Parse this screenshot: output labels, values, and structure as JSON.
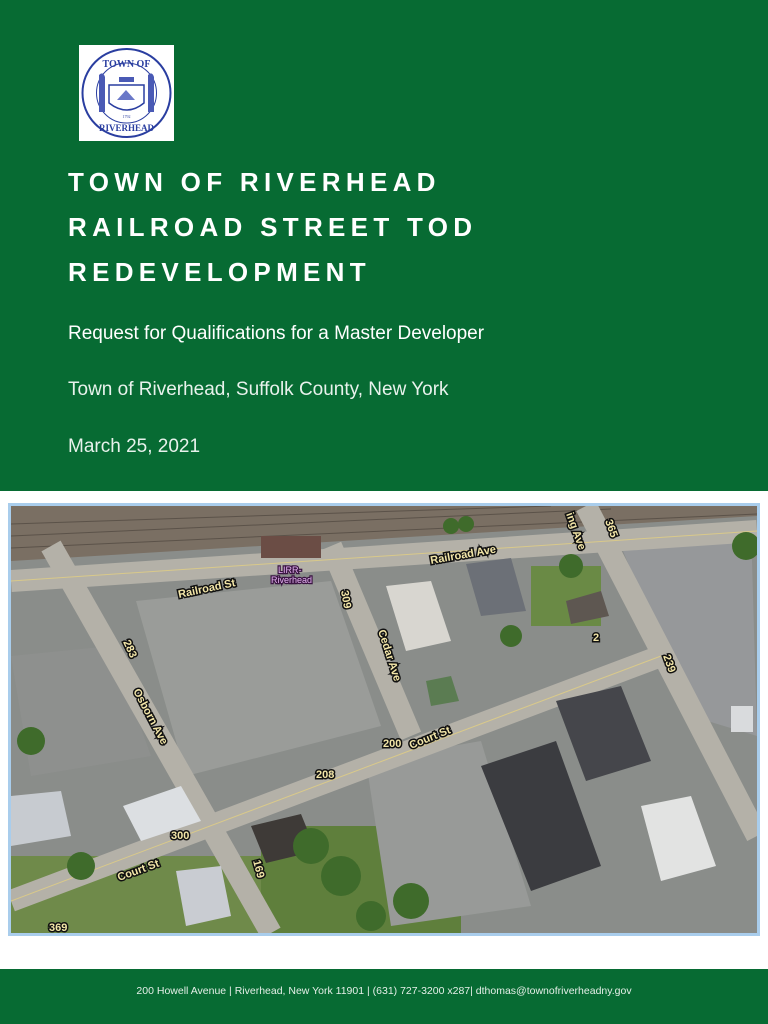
{
  "header": {
    "seal": {
      "text_top": "TOWN OF",
      "text_bottom": "RIVERHEAD",
      "year": "1792"
    },
    "title_lines": [
      "TOWN OF RIVERHEAD",
      "RAILROAD STREET TOD",
      "REDEVELOPMENT"
    ],
    "subtitle": "Request for Qualifications for a Master Developer",
    "location": "Town of Riverhead, Suffolk County, New York",
    "date": "March 25, 2021"
  },
  "aerial_labels": {
    "railroad_st": "Railroad St",
    "railroad_ave": "Railroad Ave",
    "lirr_line1": "LIRR-",
    "lirr_line2": "Riverhead",
    "cedar_ave": "Cedar Ave",
    "osborn_ave": "Osborn Ave",
    "court_st_1": "Court St",
    "court_st_2": "Court St",
    "griffing_ave": "ing Ave",
    "n283": "283",
    "n309": "309",
    "n200": "200",
    "n208": "208",
    "n300": "300",
    "n169": "169",
    "n369": "369",
    "n239": "239",
    "n365": "365",
    "n2": "2"
  },
  "footer": {
    "contact": "200 Howell Avenue | Riverhead, New York 11901 | (631) 727-3200 x287| dthomas@townofriverheadny.gov"
  },
  "colors": {
    "brand_green": "#076b33",
    "image_border": "#a9cdec"
  }
}
